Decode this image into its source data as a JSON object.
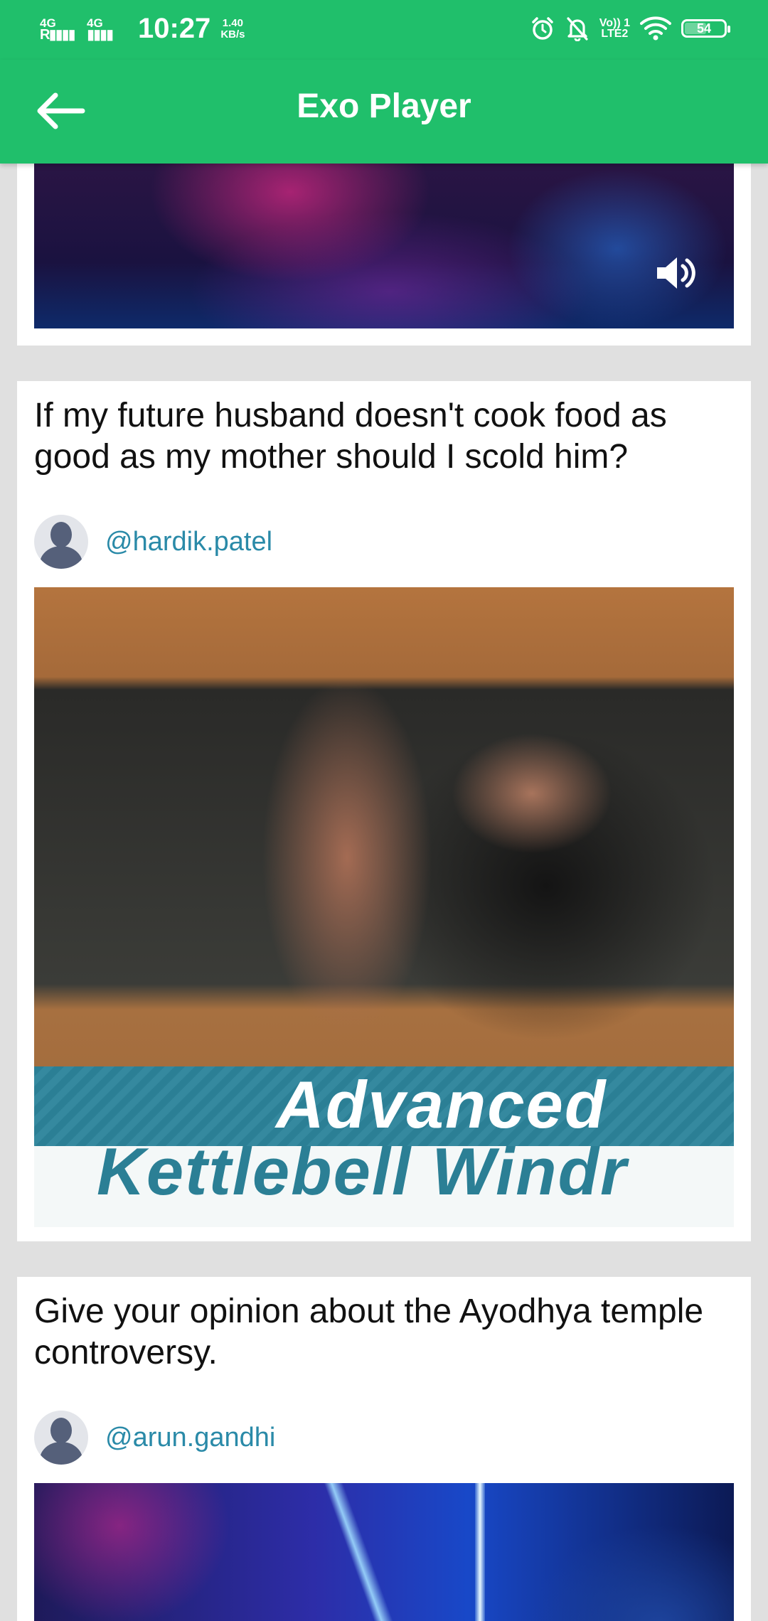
{
  "status_bar": {
    "net1_type": "4G",
    "net1_bars": "R▮▮▮▮",
    "net2_type": "4G",
    "net2_bars": "▮▮▮▮",
    "time": "10:27",
    "speed_value": "1.40",
    "speed_unit": "KB/s",
    "volte_top": "Vo)) 1",
    "volte_bottom": "LTE2",
    "battery": "54",
    "icons": [
      "alarm-icon",
      "mute-bell-icon",
      "wifi-icon",
      "battery-icon"
    ]
  },
  "app_bar": {
    "title": "Exo Player",
    "back_icon": "arrow-left-icon"
  },
  "feed": [
    {
      "media_icon": "volume-icon"
    },
    {
      "question": "If my future husband doesn't cook food as good as my mother should I scold him?",
      "author": "@hardik.patel",
      "media_text_line1": "Advanced",
      "media_text_line2": "Kettlebell Windr"
    },
    {
      "question": "Give your opinion about the Ayodhya temple controversy.",
      "author": "@arun.gandhi"
    }
  ],
  "colors": {
    "primary": "#20bf6b",
    "link": "#2a8aa8",
    "background": "#e0e0e0",
    "card": "#ffffff"
  }
}
